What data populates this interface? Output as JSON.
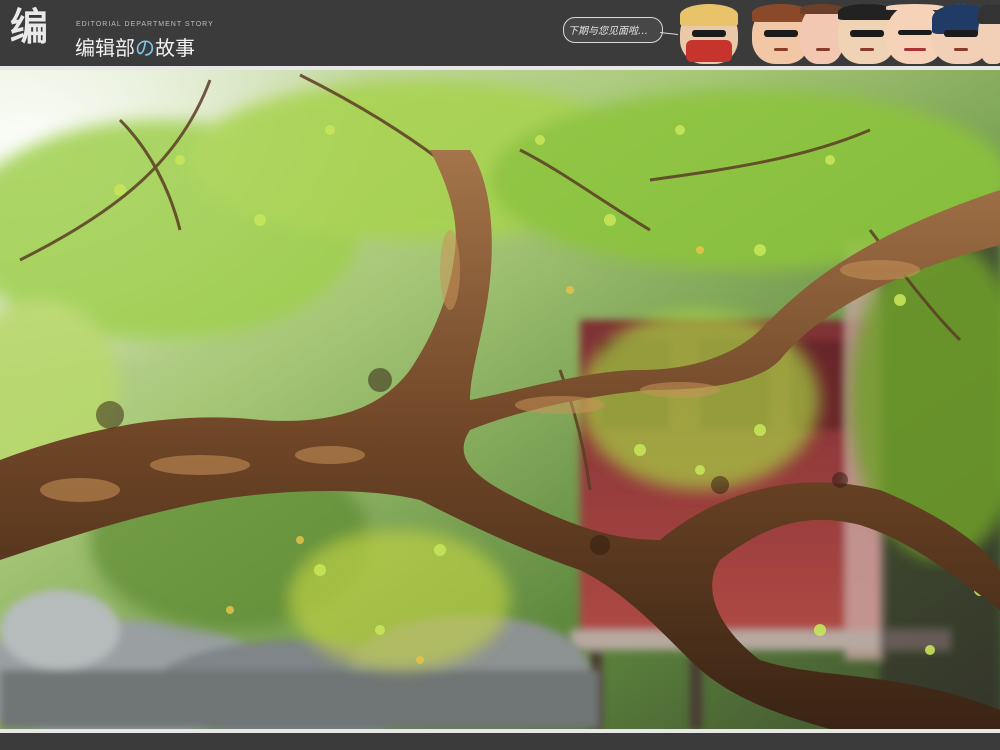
{
  "header": {
    "logo_glyph": "编",
    "subtitle": "EDITORIAL DEPARTMENT STORY",
    "title_part1": "编辑部",
    "title_no": "の",
    "title_part2": "故事",
    "speech_bubble": "下期与您见面啦…"
  },
  "photo": {
    "subject": "tree-branch-photo"
  },
  "colors": {
    "header_bg": "#3b3b3b",
    "stripe": "#e7e7e7",
    "accent_no": "#7fc6e8",
    "building_red": "#9b3a3a",
    "foliage_green": "#8cc43a"
  }
}
